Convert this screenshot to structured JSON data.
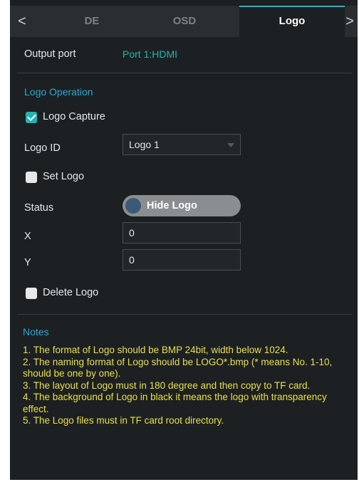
{
  "tabs": {
    "back_symbol": "<",
    "forward_symbol": ">",
    "items": [
      {
        "label": "DE"
      },
      {
        "label": "OSD"
      },
      {
        "label": "Logo"
      }
    ],
    "active": "Logo"
  },
  "output_port": {
    "label": "Output port",
    "value": "Port 1:HDMI"
  },
  "logo_operation": {
    "title": "Logo Operation",
    "logo_capture": {
      "label": "Logo Capture",
      "checked": true
    },
    "logo_id": {
      "label": "Logo ID",
      "value": "Logo 1"
    },
    "set_logo": {
      "label": "Set Logo",
      "checked": false
    },
    "status": {
      "label": "Status",
      "toggle_label": "Hide Logo"
    },
    "x": {
      "label": "X",
      "value": "0"
    },
    "y": {
      "label": "Y",
      "value": "0"
    },
    "delete_logo": {
      "label": "Delete Logo",
      "checked": false
    }
  },
  "notes": {
    "title": "Notes",
    "items": [
      "1. The format of Logo should be BMP 24bit, width below 1024.",
      "2. The naming format of Logo should be LOGO*.bmp (* means No. 1-10,  should be one by one).",
      "3. The layout of Logo must in 180 degree and then copy to TF card.",
      "4. The background of Logo in black it means the logo with transparency effect.",
      "5. The Logo files must in TF card root directory."
    ]
  },
  "colors": {
    "accent": "#1eb6b4",
    "section_title": "#2aa6d8",
    "notes_text": "#e8e04a",
    "background": "#1d2022"
  }
}
